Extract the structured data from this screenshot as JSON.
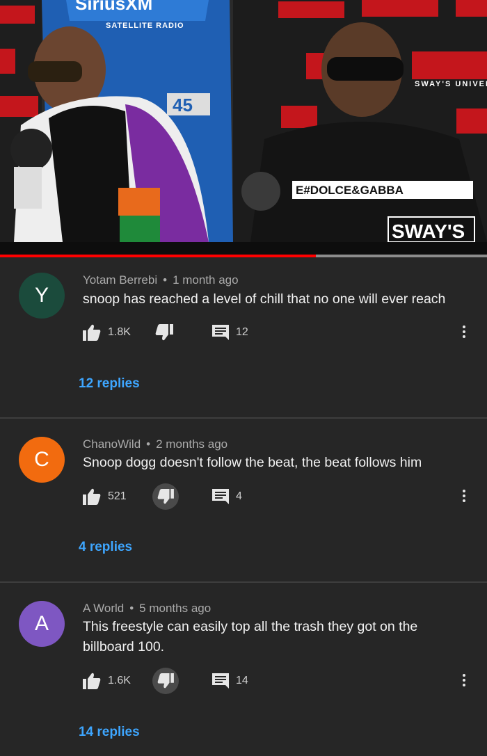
{
  "video": {
    "progress_fraction": 0.648,
    "watermark_left": "SiriusXM",
    "satellite_text": "SATELLITE RADIO",
    "number_badge": "45",
    "shirt_text": "E#DOLCE&GABBA",
    "sways_logo": "SWAY'S",
    "backdrop_brand": "SWAY'S UNIVERSE"
  },
  "comments": [
    {
      "avatar_letter": "Y",
      "avatar_color": "#1b4b3c",
      "author": "Yotam Berrebi",
      "separator": "•",
      "time": "1 month ago",
      "text": "snoop has reached a level of chill that no one will ever reach",
      "likes": "1.8K",
      "reply_count": "12",
      "replies_label": "12 replies",
      "dislike_highlight": false
    },
    {
      "avatar_letter": "C",
      "avatar_color": "#f26b0f",
      "author": "ChanoWild",
      "separator": "•",
      "time": "2 months ago",
      "text": "Snoop dogg doesn't follow the beat, the beat follows him",
      "likes": "521",
      "reply_count": "4",
      "replies_label": "4 replies",
      "dislike_highlight": true
    },
    {
      "avatar_letter": "A",
      "avatar_color": "#7e57c2",
      "author": "A World",
      "separator": "•",
      "time": "5 months ago",
      "text": "This freestyle can easily top all the trash they got on the billboard 100.",
      "likes": "1.6K",
      "reply_count": "14",
      "replies_label": "14 replies",
      "dislike_highlight": true
    }
  ],
  "icons": {
    "like": "thumb-up-icon",
    "dislike": "thumb-down-icon",
    "reply": "comment-icon",
    "more": "more-vert-icon"
  },
  "colors": {
    "link": "#3ea6ff",
    "progress": "#ff0000",
    "background": "#262626"
  }
}
